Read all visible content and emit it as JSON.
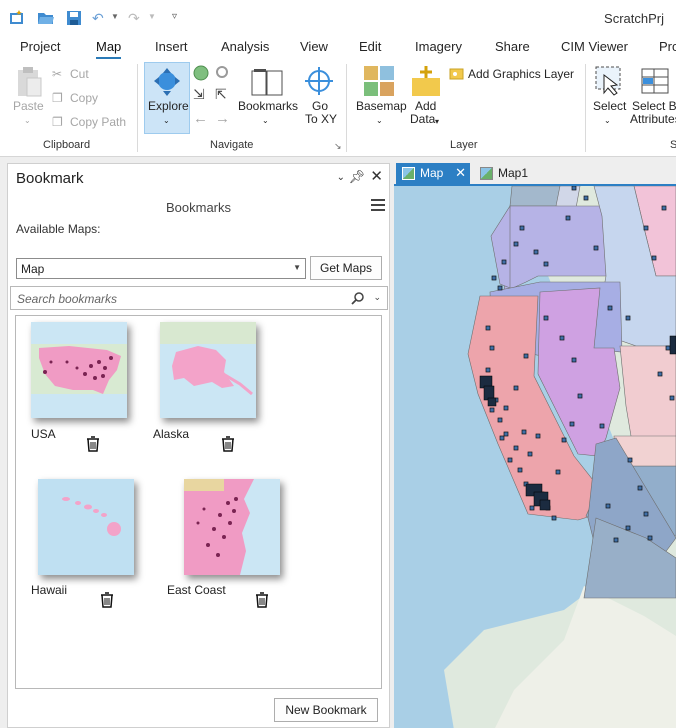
{
  "project_name": "ScratchPrj",
  "ribbon_tabs": [
    "Project",
    "Map",
    "Insert",
    "Analysis",
    "View",
    "Edit",
    "Imagery",
    "Share",
    "CIM Viewer",
    "Pro"
  ],
  "active_tab": "Map",
  "clipboard": {
    "paste": "Paste",
    "cut": "Cut",
    "copy": "Copy",
    "copy_path": "Copy Path",
    "group": "Clipboard"
  },
  "navigate": {
    "explore": "Explore",
    "bookmarks": "Bookmarks",
    "goto_line1": "Go",
    "goto_line2": "To XY",
    "group": "Navigate"
  },
  "layer": {
    "basemap": "Basemap",
    "add_line1": "Add",
    "add_line2": "Data",
    "add_graphics": "Add Graphics Layer",
    "group": "Layer"
  },
  "selection": {
    "select": "Select",
    "select_by_line1": "Select By",
    "select_by_line2": "Attributes",
    "group": "S"
  },
  "bookmark_pane": {
    "title": "Bookmark",
    "subtitle": "Bookmarks",
    "available_maps_label": "Available Maps:",
    "map_select_value": "Map",
    "get_maps": "Get Maps",
    "search_placeholder": "Search bookmarks",
    "new_bookmark": "New Bookmark",
    "bookmarks": [
      {
        "name": "USA"
      },
      {
        "name": "Alaska"
      },
      {
        "name": "Hawaii"
      },
      {
        "name": "East Coast"
      }
    ]
  },
  "map_tabs": [
    {
      "label": "Map",
      "active": true
    },
    {
      "label": "Map1",
      "active": false
    }
  ],
  "colors": {
    "accent": "#2c7fc4",
    "selected_button": "#cce4f7"
  }
}
